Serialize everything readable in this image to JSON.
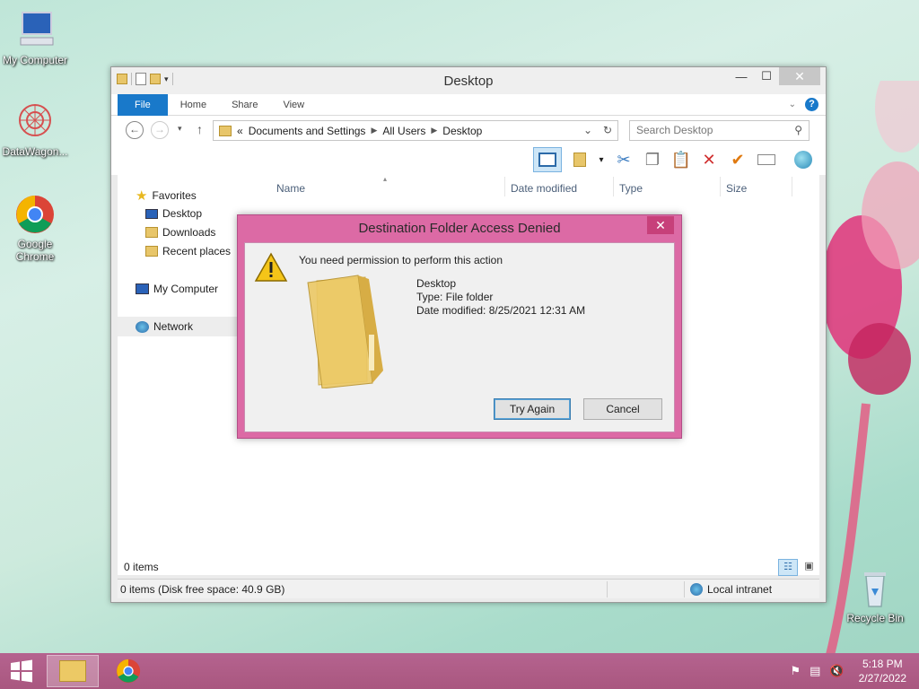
{
  "desktop": {
    "icons": [
      {
        "label": "My Computer",
        "icon": "computer-icon"
      },
      {
        "label": "DataWagon...",
        "icon": "datawagon-icon"
      },
      {
        "label": "Google Chrome",
        "icon": "chrome-icon"
      },
      {
        "label": "Recycle Bin",
        "icon": "recycle-bin-icon"
      }
    ]
  },
  "window": {
    "title": "Desktop",
    "ribbon_tabs": [
      "File",
      "Home",
      "Share",
      "View"
    ],
    "address": [
      "«",
      "Documents and Settings",
      "All Users",
      "Desktop"
    ],
    "search_placeholder": "Search Desktop",
    "columns": [
      "Name",
      "Date modified",
      "Type",
      "Size"
    ],
    "nav": {
      "favorites": "Favorites",
      "favorites_items": [
        "Desktop",
        "Downloads",
        "Recent places"
      ],
      "computer": "My Computer",
      "network": "Network"
    },
    "item_count": "0 items",
    "status_left": "0 items (Disk free space: 40.9 GB)",
    "status_right": "Local intranet"
  },
  "dialog": {
    "title": "Destination Folder Access Denied",
    "message": "You need permission to perform this action",
    "item_name": "Desktop",
    "item_type": "Type: File folder",
    "item_date": "Date modified: 8/25/2021 12:31 AM",
    "try_again": "Try Again",
    "cancel": "Cancel"
  },
  "taskbar": {
    "time": "5:18 PM",
    "date": "2/27/2022"
  },
  "colors": {
    "accent": "#1979ca",
    "dialog_frame": "#dc6aa5",
    "taskbar": "#b05d88"
  }
}
